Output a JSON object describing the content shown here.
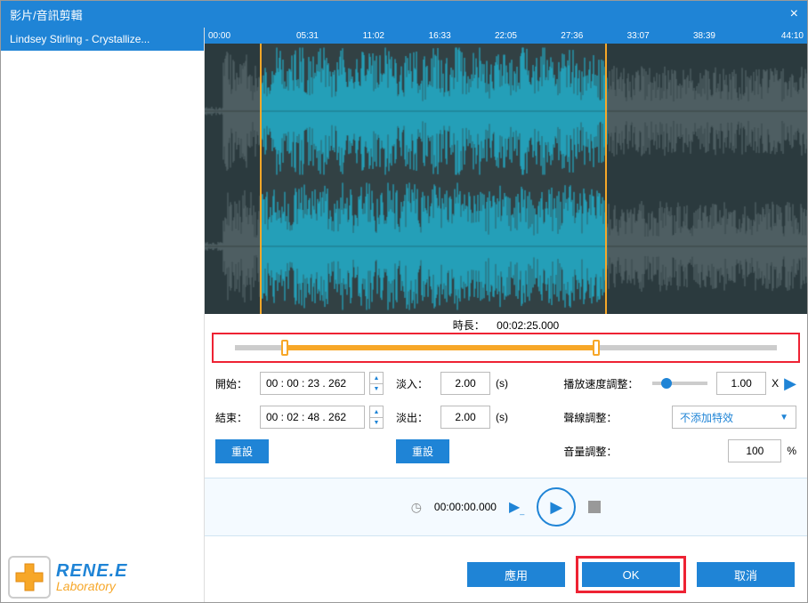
{
  "window": {
    "title": "影片/音訊剪輯"
  },
  "filelist": {
    "items": [
      {
        "label": "Lindsey Stirling - Crystallize..."
      }
    ]
  },
  "ruler": {
    "ticks": [
      "00:00",
      "05:31",
      "11:02",
      "16:33",
      "22:05",
      "27:36",
      "33:07",
      "38:39",
      "44:10"
    ]
  },
  "selection": {
    "start_pct": 9.2,
    "end_pct": 66.7
  },
  "duration": {
    "label": "時長：",
    "value": "00:02:25.000"
  },
  "range_slider": {
    "start_pct": 9.2,
    "end_pct": 66.7
  },
  "start_end": {
    "start_label": "開始：",
    "start_value": "00 : 00 : 23 . 262",
    "end_label": "結束：",
    "end_value": "00 : 02 : 48 . 262",
    "reset": "重設"
  },
  "fade": {
    "in_label": "淡入：",
    "in_value": "2.00",
    "out_label": "淡出：",
    "out_value": "2.00",
    "unit": "(s)",
    "reset": "重設"
  },
  "right_controls": {
    "speed_label": "播放速度調整：",
    "speed_value": "1.00",
    "speed_suffix": "X",
    "voice_label": "聲線調整：",
    "voice_select": "不添加特效",
    "volume_label": "音量調整：",
    "volume_value": "100",
    "volume_suffix": "%"
  },
  "playbar": {
    "time": "00:00:00.000"
  },
  "logo": {
    "line1": "RENE.E",
    "line2": "Laboratory"
  },
  "buttons": {
    "apply": "應用",
    "ok": "OK",
    "cancel": "取消"
  }
}
